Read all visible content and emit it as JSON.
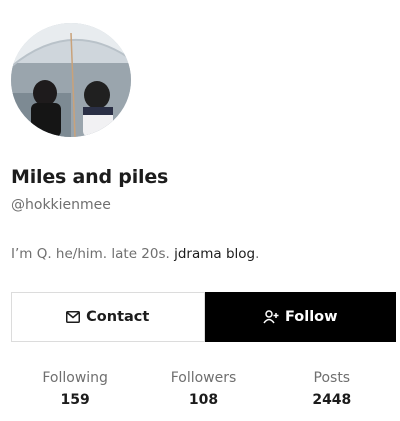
{
  "profile": {
    "display_name": "Miles and piles",
    "handle": "@hokkienmee",
    "bio_text": "I’m Q. he/him. late 20s. ",
    "bio_link": "jdrama blog",
    "bio_suffix": "."
  },
  "actions": {
    "contact_label": "Contact",
    "follow_label": "Follow",
    "contact_icon": "envelope-icon",
    "follow_icon": "user-plus-icon"
  },
  "stats": [
    {
      "label": "Following",
      "value": "159"
    },
    {
      "label": "Followers",
      "value": "108"
    },
    {
      "label": "Posts",
      "value": "2448"
    }
  ],
  "colors": {
    "primary_button_bg": "#000000",
    "primary_button_text": "#ffffff",
    "muted_text": "#6f6f6f",
    "border": "#dcdcdc"
  }
}
